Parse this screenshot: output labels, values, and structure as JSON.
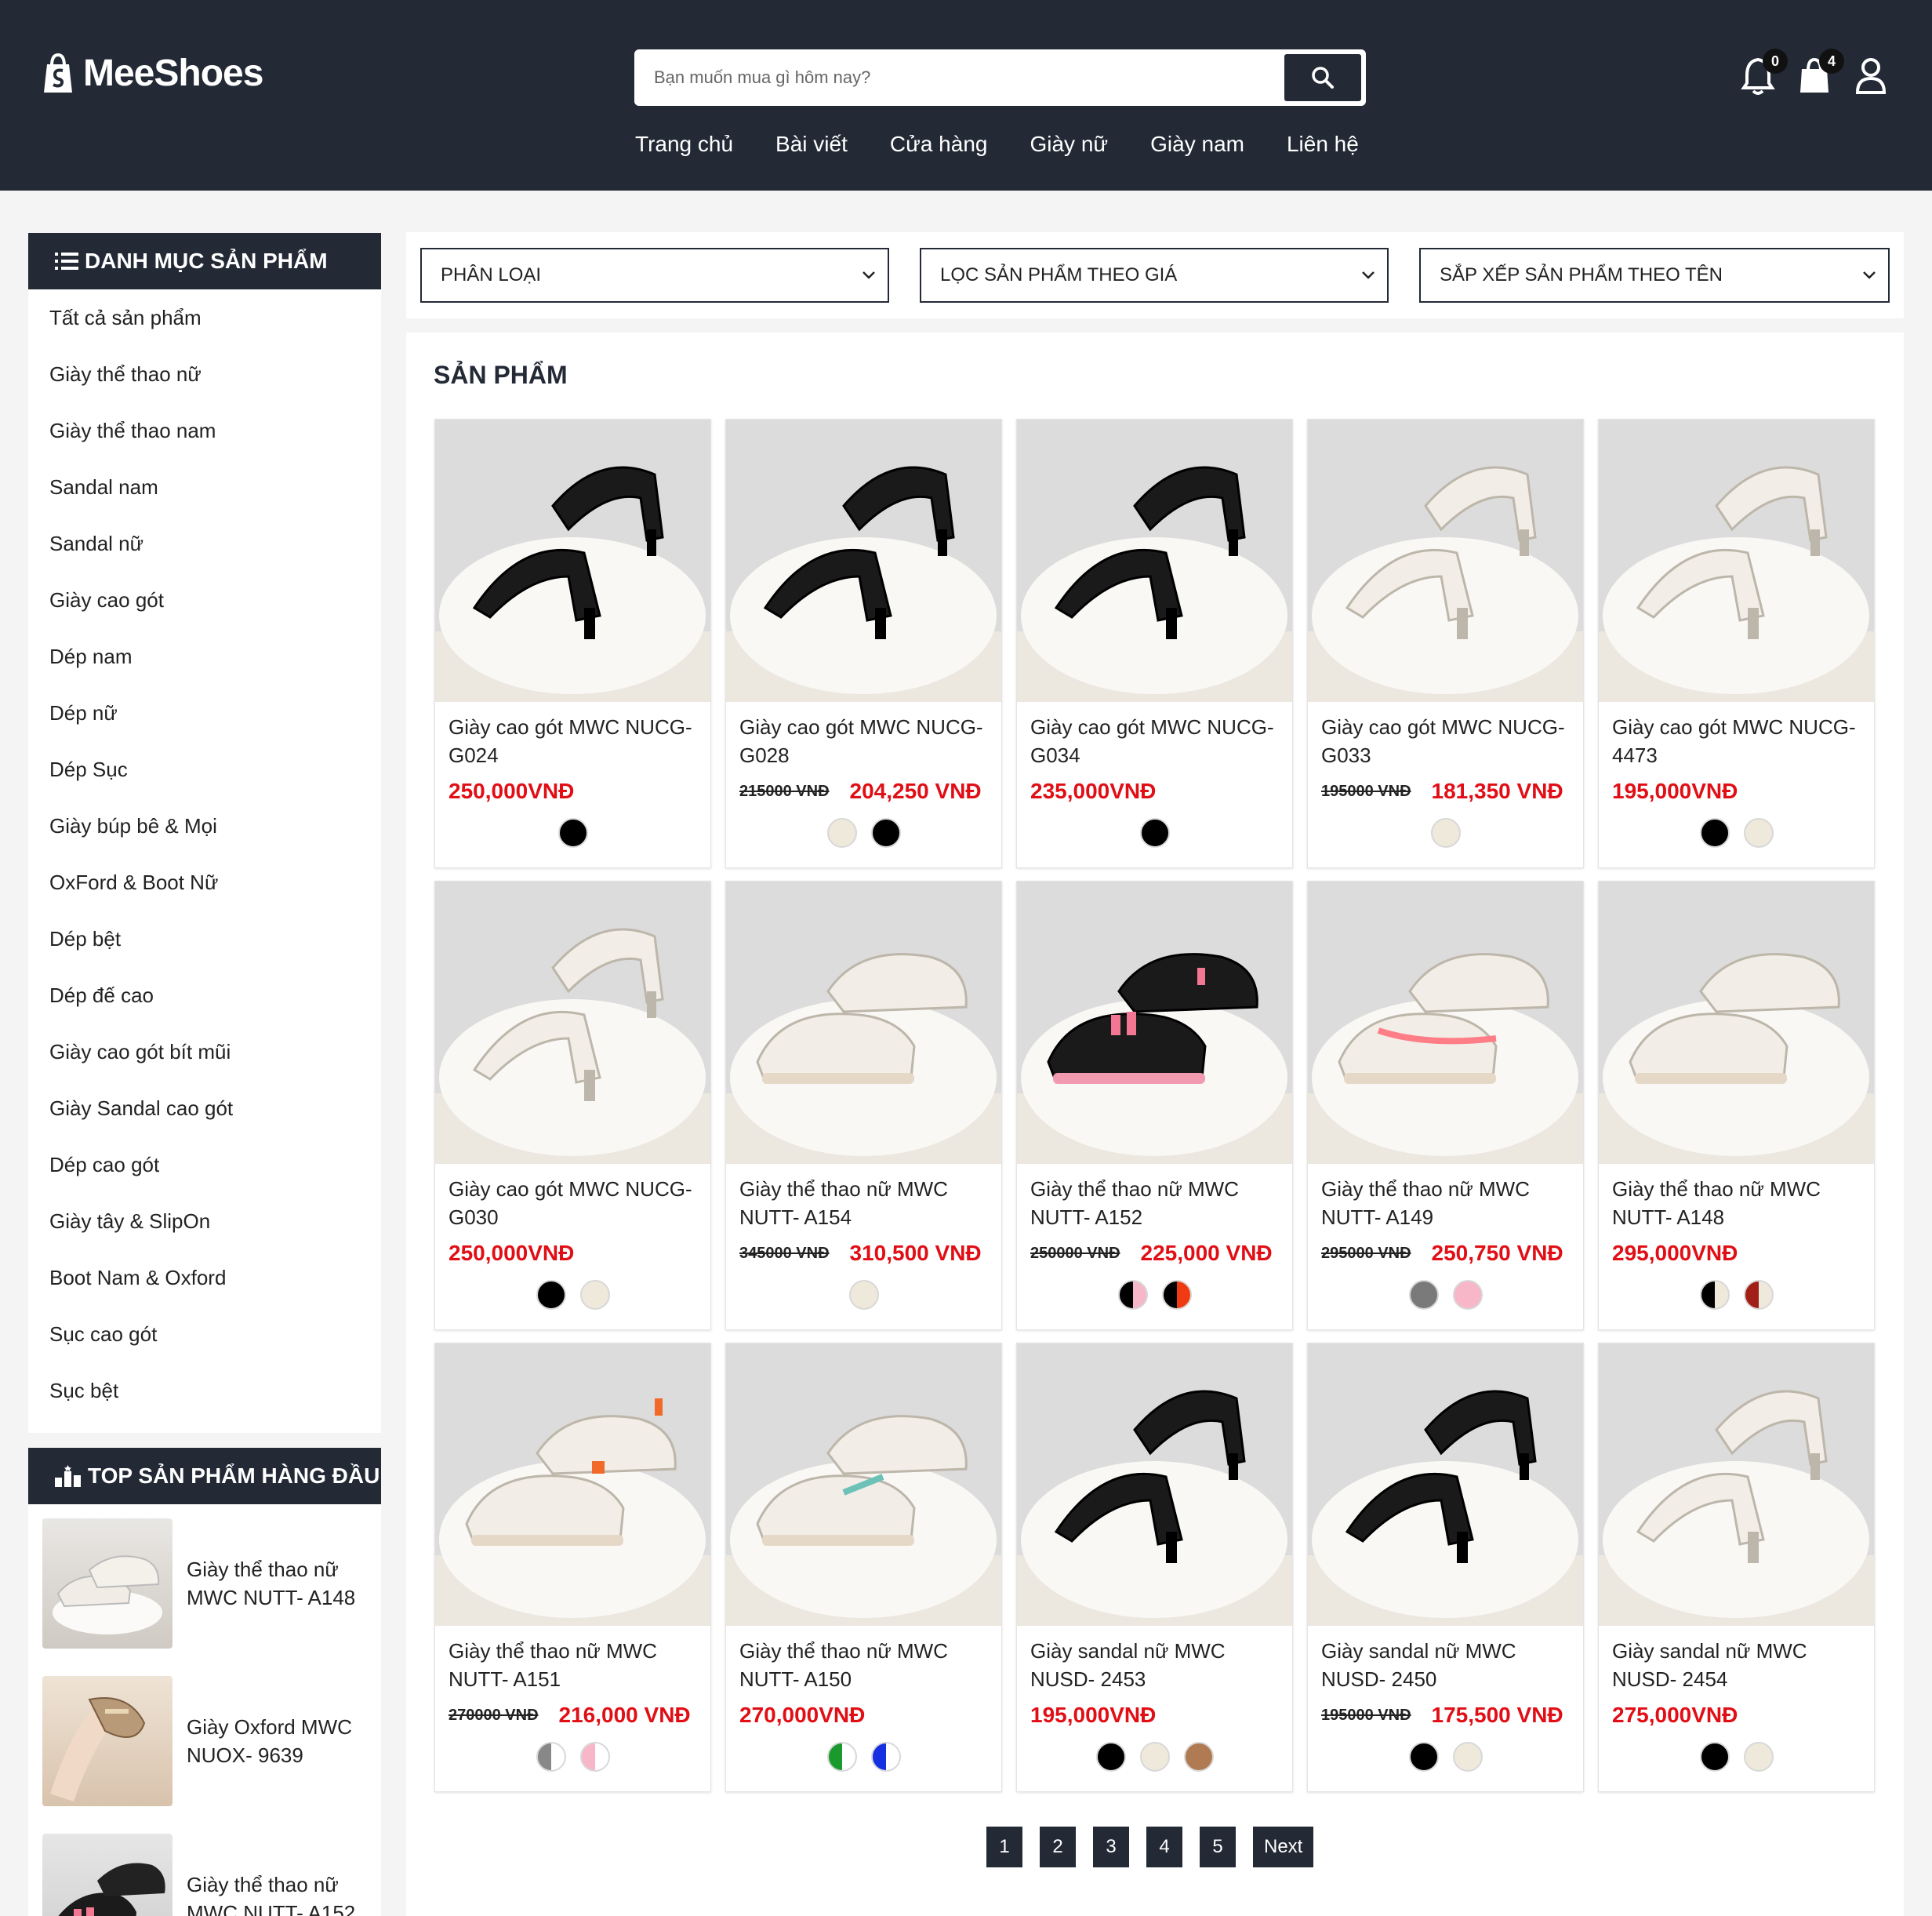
{
  "brand": {
    "name": "MeeShoes"
  },
  "search": {
    "placeholder": "Bạn muốn mua gì hôm nay?"
  },
  "nav": [
    "Trang chủ",
    "Bài viết",
    "Cửa hàng",
    "Giày nữ",
    "Giày nam",
    "Liên hệ"
  ],
  "header_icons": {
    "notifications_count": "0",
    "cart_count": "4"
  },
  "sidebar": {
    "categories_title": "DANH MỤC SẢN PHẨM",
    "categories": [
      "Tất cả sản phẩm",
      "Giày thể thao nữ",
      "Giày thể thao nam",
      "Sandal nam",
      "Sandal nữ",
      "Giày cao gót",
      "Dép nam",
      "Dép nữ",
      "Dép Sục",
      "Giày búp bê & Mọi",
      "OxFord & Boot Nữ",
      "Dép bệt",
      "Dép đế cao",
      "Giày cao gót bít mũi",
      "Giày Sandal cao gót",
      "Dép cao gót",
      "Giày tây & SlipOn",
      "Boot Nam & Oxford",
      "Sục cao gót",
      "Sục bệt"
    ],
    "top_title": "TOP SẢN PHẨM HÀNG ĐẦU",
    "top_products": [
      "Giày thể thao nữ MWC NUTT- A148",
      "Giày Oxford MWC NUOX- 9639",
      "Giày thể thao nữ MWC NUTT- A152"
    ]
  },
  "filters": [
    "PHÂN LOẠI",
    "LỌC SẢN PHẨM THEO GIÁ",
    "SẮP XẾP SẢN PHẨM THEO TÊN"
  ],
  "products_title": "SẢN PHẨM",
  "products": [
    {
      "name": "Giày cao gót MWC NUCG-G024",
      "old": "",
      "price": "250,000VNĐ",
      "colors": [
        "#000000"
      ]
    },
    {
      "name": "Giày cao gót MWC NUCG-G028",
      "old": "215000 VNĐ",
      "price": "204,250 VNĐ",
      "colors": [
        "#efe9dc",
        "#000000"
      ]
    },
    {
      "name": "Giày cao gót MWC NUCG-G034",
      "old": "",
      "price": "235,000VNĐ",
      "colors": [
        "#000000"
      ]
    },
    {
      "name": "Giày cao gót MWC NUCG-G033",
      "old": "195000 VNĐ",
      "price": "181,350 VNĐ",
      "colors": [
        "#efe9dc"
      ]
    },
    {
      "name": "Giày cao gót MWC NUCG-4473",
      "old": "",
      "price": "195,000VNĐ",
      "colors": [
        "#000000",
        "#efe9dc"
      ]
    },
    {
      "name": "Giày cao gót MWC NUCG-G030",
      "old": "",
      "price": "250,000VNĐ",
      "colors": [
        "#000000",
        "#efe9dc"
      ]
    },
    {
      "name": "Giày thể thao nữ MWC NUTT- A154",
      "old": "345000 VNĐ",
      "price": "310,500 VNĐ",
      "colors": [
        "#efe9dc"
      ]
    },
    {
      "name": "Giày thể thao nữ MWC NUTT- A152",
      "old": "250000 VNĐ",
      "price": "225,000 VNĐ",
      "colors": [
        "half:#000000:#f6b8c8",
        "half:#000000:#f03a12"
      ]
    },
    {
      "name": "Giày thể thao nữ MWC NUTT- A149",
      "old": "295000 VNĐ",
      "price": "250,750 VNĐ",
      "colors": [
        "#7a7a7a",
        "#f7b7c8"
      ]
    },
    {
      "name": "Giày thể thao nữ MWC NUTT- A148",
      "old": "",
      "price": "295,000VNĐ",
      "colors": [
        "half:#000000:#efe9dc",
        "half:#a11f17:#efe9dc"
      ]
    },
    {
      "name": "Giày thể thao nữ MWC NUTT- A151",
      "old": "270000 VNĐ",
      "price": "216,000 VNĐ",
      "colors": [
        "half:#888888:#ffffff",
        "half:#f7b7c8:#ffffff"
      ]
    },
    {
      "name": "Giày thể thao nữ MWC NUTT- A150",
      "old": "",
      "price": "270,000VNĐ",
      "colors": [
        "half:#1a9a2c:#ffffff",
        "half:#1530e0:#ffffff"
      ]
    },
    {
      "name": "Giày sandal nữ MWC NUSD- 2453",
      "old": "",
      "price": "195,000VNĐ",
      "colors": [
        "#000000",
        "#efe9dc",
        "#b07a52"
      ]
    },
    {
      "name": "Giày sandal nữ MWC NUSD- 2450",
      "old": "195000 VNĐ",
      "price": "175,500 VNĐ",
      "colors": [
        "#000000",
        "#efe9dc"
      ]
    },
    {
      "name": "Giày sandal nữ MWC NUSD- 2454",
      "old": "",
      "price": "275,000VNĐ",
      "colors": [
        "#000000",
        "#efe9dc"
      ]
    }
  ],
  "pagination": [
    "1",
    "2",
    "3",
    "4",
    "5",
    "Next"
  ]
}
